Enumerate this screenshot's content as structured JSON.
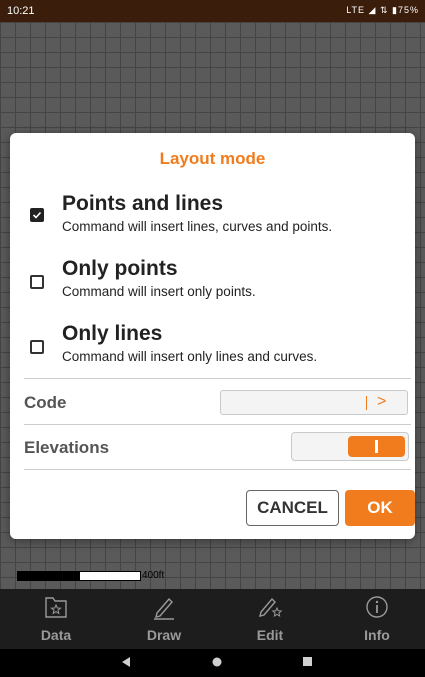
{
  "status_bar": {
    "time": "10:21",
    "indicators": "LTE ◢ ⇅ ▮75%"
  },
  "map": {
    "scale_label": "400ft"
  },
  "dialog": {
    "title": "Layout mode",
    "options": [
      {
        "title": "Points and lines",
        "description": "Command will insert lines, curves and points.",
        "checked": true
      },
      {
        "title": "Only points",
        "description": "Command will insert only points.",
        "checked": false
      },
      {
        "title": "Only lines",
        "description": "Command will insert only lines and curves.",
        "checked": false
      }
    ],
    "code_label": "Code",
    "code_value": "",
    "elevations_label": "Elevations",
    "elevations_on": true,
    "cancel_label": "CANCEL",
    "ok_label": "OK"
  },
  "nav": {
    "items": [
      {
        "label": "Data",
        "icon": "folder-star-icon"
      },
      {
        "label": "Draw",
        "icon": "pencil-icon"
      },
      {
        "label": "Edit",
        "icon": "pencil-star-icon"
      },
      {
        "label": "Info",
        "icon": "info-icon"
      }
    ]
  },
  "colors": {
    "accent": "#f07c1d",
    "status_bar": "#3b1d0c",
    "nav_bg": "#1d1d1d"
  }
}
